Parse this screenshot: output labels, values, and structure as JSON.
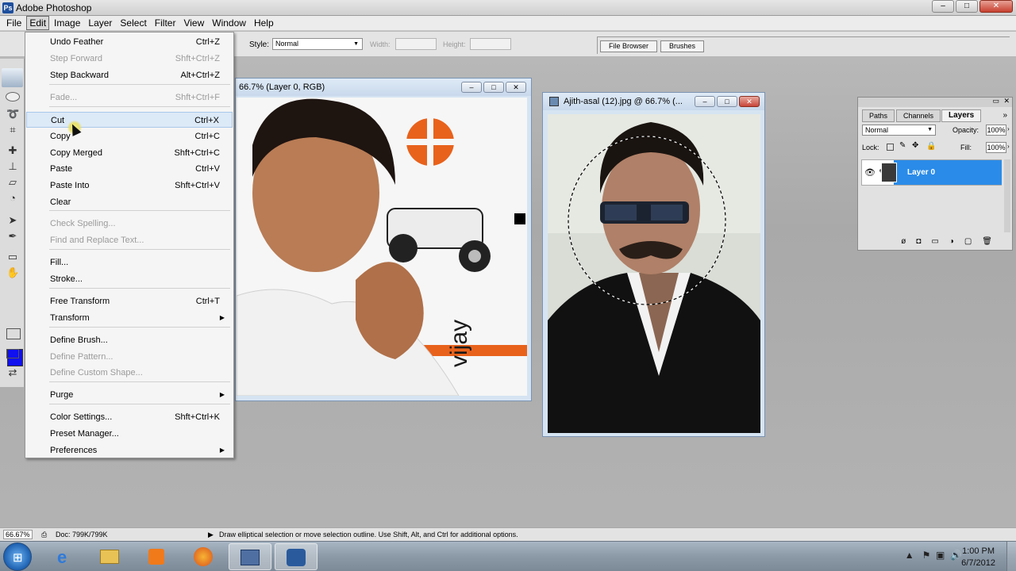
{
  "app": {
    "title": "Adobe Photoshop"
  },
  "window_controls": {
    "minimize": "–",
    "maximize": "□",
    "close": "✕"
  },
  "menubar": [
    "File",
    "Edit",
    "Image",
    "Layer",
    "Select",
    "Filter",
    "View",
    "Window",
    "Help"
  ],
  "options_bar": {
    "style_label": "Style:",
    "style_value": "Normal",
    "width_label": "Width:",
    "height_label": "Height:",
    "palette_tabs": [
      "File Browser",
      "Brushes"
    ]
  },
  "edit_menu": {
    "items": [
      {
        "label": "Undo Feather",
        "shortcut": "Ctrl+Z",
        "enabled": true
      },
      {
        "label": "Step Forward",
        "shortcut": "Shft+Ctrl+Z",
        "enabled": false
      },
      {
        "label": "Step Backward",
        "shortcut": "Alt+Ctrl+Z",
        "enabled": true
      },
      {
        "label": "Fade...",
        "shortcut": "Shft+Ctrl+F",
        "enabled": false
      },
      {
        "label": "Cut",
        "shortcut": "Ctrl+X",
        "enabled": true,
        "hover": true
      },
      {
        "label": "Copy",
        "shortcut": "Ctrl+C",
        "enabled": true
      },
      {
        "label": "Copy Merged",
        "shortcut": "Shft+Ctrl+C",
        "enabled": true
      },
      {
        "label": "Paste",
        "shortcut": "Ctrl+V",
        "enabled": true
      },
      {
        "label": "Paste Into",
        "shortcut": "Shft+Ctrl+V",
        "enabled": true
      },
      {
        "label": "Clear",
        "shortcut": "",
        "enabled": true
      },
      {
        "label": "Check Spelling...",
        "shortcut": "",
        "enabled": false
      },
      {
        "label": "Find and Replace Text...",
        "shortcut": "",
        "enabled": false
      },
      {
        "label": "Fill...",
        "shortcut": "",
        "enabled": true
      },
      {
        "label": "Stroke...",
        "shortcut": "",
        "enabled": true
      },
      {
        "label": "Free Transform",
        "shortcut": "Ctrl+T",
        "enabled": true
      },
      {
        "label": "Transform",
        "shortcut": "",
        "enabled": true,
        "submenu": true
      },
      {
        "label": "Define Brush...",
        "shortcut": "",
        "enabled": true
      },
      {
        "label": "Define Pattern...",
        "shortcut": "",
        "enabled": false
      },
      {
        "label": "Define Custom Shape...",
        "shortcut": "",
        "enabled": false
      },
      {
        "label": "Purge",
        "shortcut": "",
        "enabled": true,
        "submenu": true
      },
      {
        "label": "Color Settings...",
        "shortcut": "Shft+Ctrl+K",
        "enabled": true
      },
      {
        "label": "Preset Manager...",
        "shortcut": "",
        "enabled": true
      },
      {
        "label": "Preferences",
        "shortcut": "",
        "enabled": true,
        "submenu": true
      }
    ]
  },
  "doc_left": {
    "title": "66.7% (Layer 0, RGB)",
    "image_text": "vijay"
  },
  "doc_right": {
    "title": "Ajith-asal (12).jpg @ 66.7% (..."
  },
  "layers_palette": {
    "tabs": [
      "Paths",
      "Channels",
      "Layers"
    ],
    "blend_mode": "Normal",
    "opacity_label": "Opacity:",
    "opacity_value": "100%",
    "lock_label": "Lock:",
    "fill_label": "Fill:",
    "fill_value": "100%",
    "layer_name": "Layer 0"
  },
  "status_bar": {
    "zoom": "66.67%",
    "doc": "Doc: 799K/799K",
    "hint": "Draw elliptical selection or move selection outline.  Use Shift, Alt, and Ctrl for additional options."
  },
  "taskbar": {
    "time": "1:00 PM",
    "date": "6/7/2012"
  },
  "colors": {
    "foreground": "#1010f0",
    "layer_selected": "#2a8be8",
    "orange_accent": "#e8621c"
  }
}
